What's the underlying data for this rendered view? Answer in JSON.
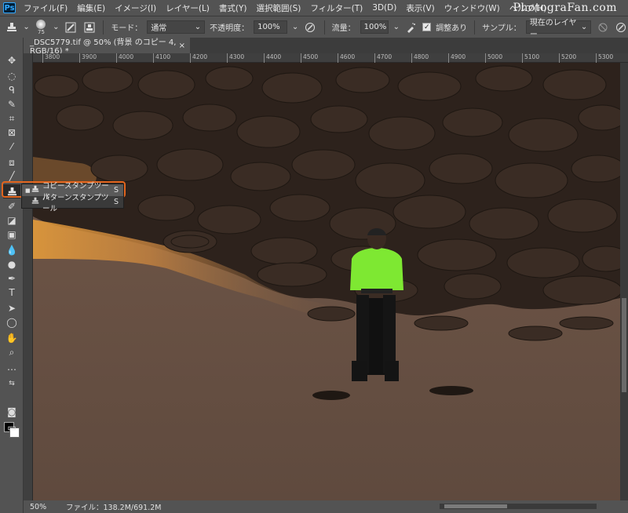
{
  "app": {
    "logo": "Ps",
    "brand": "PhotograFan.com"
  },
  "menu": [
    "ファイル(F)",
    "編集(E)",
    "イメージ(I)",
    "レイヤー(L)",
    "書式(Y)",
    "選択範囲(S)",
    "フィルター(T)",
    "3D(D)",
    "表示(V)",
    "ウィンドウ(W)",
    "ヘルプ(H)"
  ],
  "options": {
    "brush_size": "75",
    "mode_label": "モード：",
    "mode_value": "通常",
    "opacity_label": "不透明度：",
    "opacity_value": "100%",
    "flow_label": "流量：",
    "flow_value": "100%",
    "aligned_label": "調整あり",
    "aligned_checked": true,
    "sample_label": "サンプル：",
    "sample_value": "現在のレイヤー"
  },
  "document": {
    "tab_title": "_DSC5779.tif @ 50% (背景 のコピー 4, RGB/16) *",
    "close": "×"
  },
  "ruler": {
    "h_ticks": [
      "3800",
      "3900",
      "4000",
      "4100",
      "4200",
      "4300",
      "4400",
      "4500",
      "4600",
      "4700",
      "4800",
      "4900",
      "5000",
      "5100",
      "5200",
      "5300"
    ]
  },
  "flyout": [
    {
      "label": "コピースタンプツール",
      "key": "S",
      "selected": true
    },
    {
      "label": "パターンスタンプツール",
      "key": "S",
      "selected": false
    }
  ],
  "status": {
    "zoom": "50%",
    "file": "ファイル：138.2M/691.2M"
  },
  "colors": {
    "accent_highlight": "#e2651e",
    "ui_panel": "#535353",
    "shirt": "#7ee832"
  }
}
